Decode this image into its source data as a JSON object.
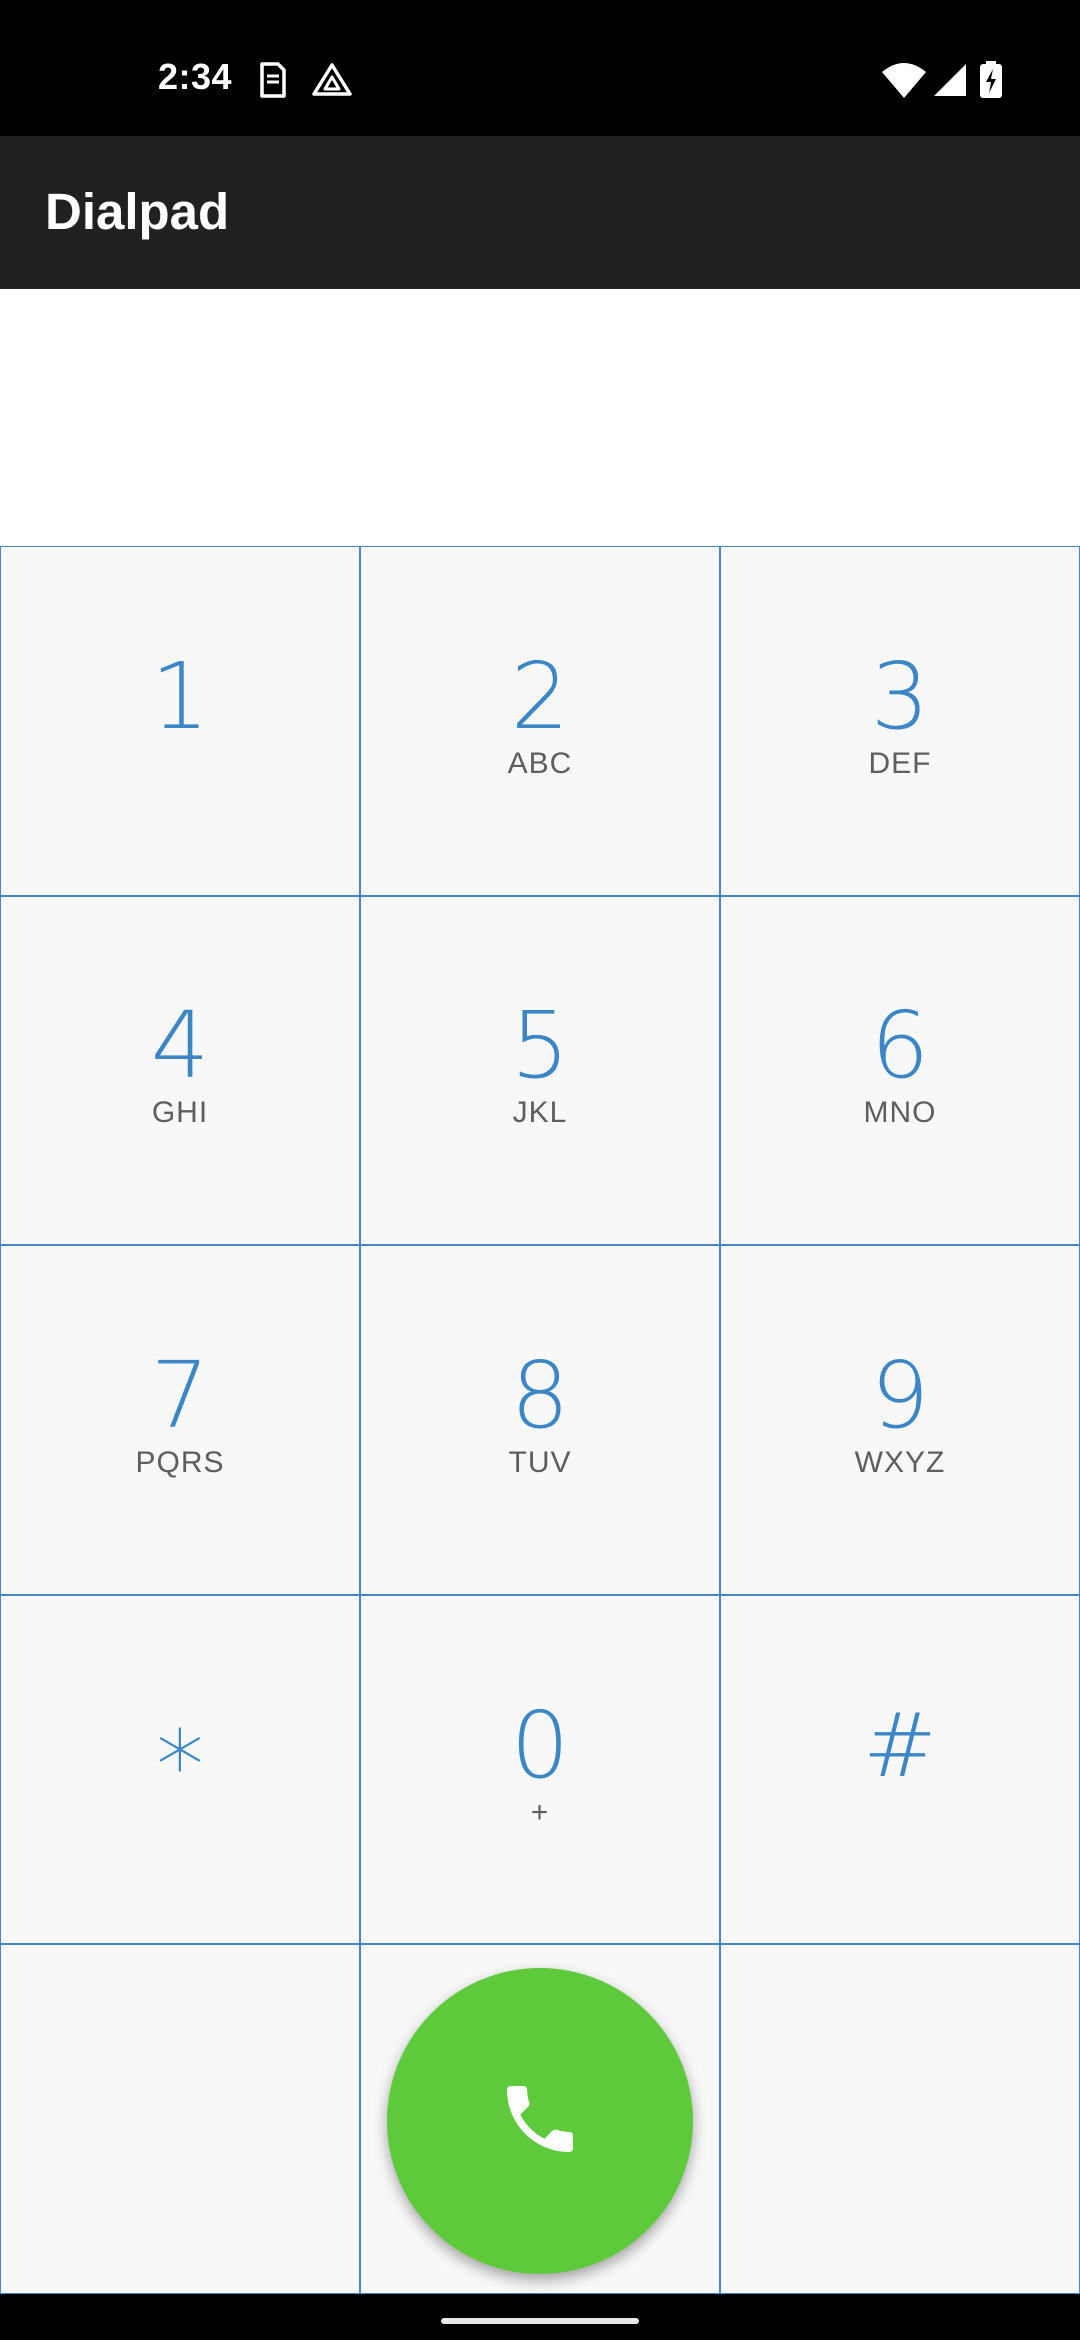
{
  "status_bar": {
    "time": "2:34",
    "left_icons": [
      "sim-card-icon",
      "drive-icon"
    ],
    "right_icons": [
      "wifi-icon",
      "cellular-signal-icon",
      "battery-charging-icon"
    ]
  },
  "app_bar": {
    "title": "Dialpad",
    "background_color": "#212121"
  },
  "number_display": {
    "value": ""
  },
  "keypad": {
    "accent_color": "#3d86c6",
    "keys": [
      {
        "digit": "1",
        "letters": ""
      },
      {
        "digit": "2",
        "letters": "ABC"
      },
      {
        "digit": "3",
        "letters": "DEF"
      },
      {
        "digit": "4",
        "letters": "GHI"
      },
      {
        "digit": "5",
        "letters": "JKL"
      },
      {
        "digit": "6",
        "letters": "MNO"
      },
      {
        "digit": "7",
        "letters": "PQRS"
      },
      {
        "digit": "8",
        "letters": "TUV"
      },
      {
        "digit": "9",
        "letters": "WXYZ"
      },
      {
        "digit": "*",
        "letters": ""
      },
      {
        "digit": "0",
        "letters": "+"
      },
      {
        "digit": "#",
        "letters": ""
      }
    ]
  },
  "call_button": {
    "icon": "phone-icon",
    "color": "#5ec93b"
  }
}
